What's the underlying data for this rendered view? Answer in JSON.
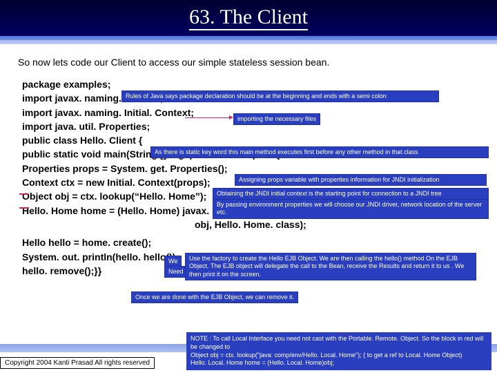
{
  "title": "63. The Client",
  "intro": "So now  lets code our Client to access our simple stateless session bean.",
  "code": {
    "l1": "package examples;",
    "l2": "import javax. naming. Context;",
    "l3": "import javax. naming. Initial. Context;",
    "l4": "import java. util. Properties;",
    "l5": "public class Hello. Client {",
    "l6": "public static void main(String [] args) throws Exception{",
    "l7": "Properties props = System. get. Properties();",
    "l8": "Context ctx = new Initial. Context(props);",
    "l9": "Object obj = ctx. lookup(“Hello. Home”);",
    "l10": "Hello. Home home = (Hello. Home) javax. rmi. Portable. Remote. Object. narrow(",
    "l11": "obj, Hello. Home. class);",
    "l12": "Hello hello = home. create();",
    "l13": "System. out. println(hello. hello());",
    "l14": "hello. remove();}}"
  },
  "ann": {
    "a1": "Rules of Java says package declaration  should be  at the beginning and ends with a semi colon",
    "a2": "importing the necessary files",
    "a3": "As there is static key word this main method executes first before any other method in that class",
    "a4": "Assigning props variable with properties information for JNDI initialization",
    "a5": "Obtaining the JNDI initial context is the starting point for connection to a JNDI tree",
    "a6": "By passing environment  properties we will choose our JNDI  driver, network location of the server  etc.",
    "a7a": "We",
    "a7b": "Need",
    "a8": "Use the factory to create the Hello EJB Object. We are then calling the hello() method On the EJB Object. The EJB object will delegate the call to the Bean, receive the Results and  return it to us . We then print it on the screen.",
    "a9": "Once we are done with the EJB Object, we can remove it.",
    "note": "NOTE :  To call Local Interface you need not cast with the Portable. Remote. Object. So the block in red will  be changed to\nObject obj =  ctx. lookup(\"java: comp/env/Hello. Local. Home\");  ( to get a ref to Local. Home Object)\nHello. Local. Home  home = (Hello. Local. Home)obj;"
  },
  "copyright": "Copyright 2004 Kanti Prasad  All rights reserved"
}
